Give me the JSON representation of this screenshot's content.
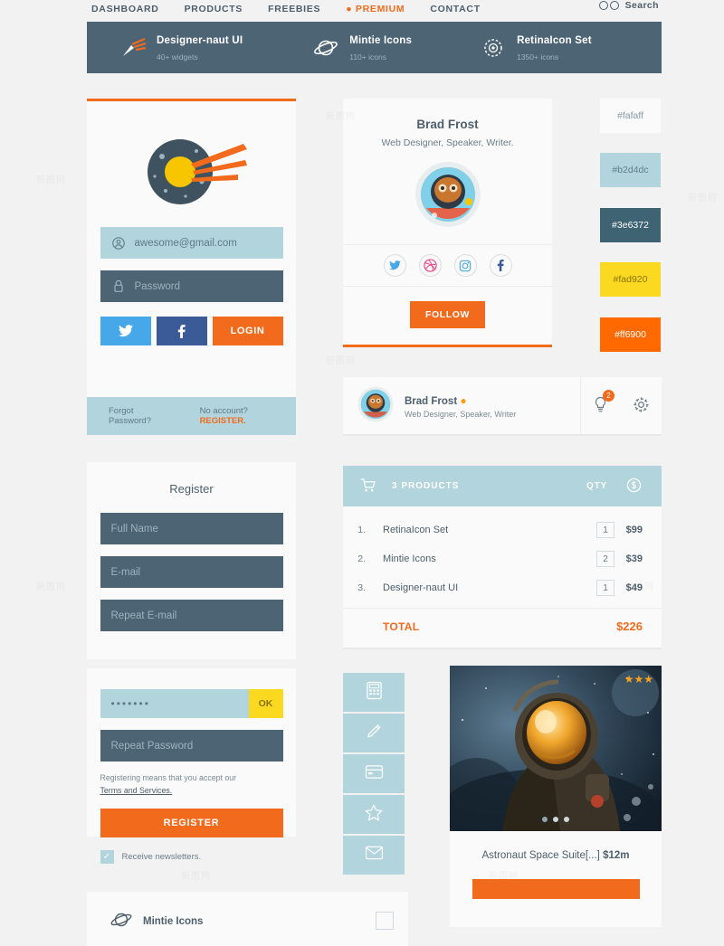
{
  "nav": {
    "links": [
      {
        "label": "DASHBOARD",
        "active": false
      },
      {
        "label": "PRODUCTS",
        "active": false
      },
      {
        "label": "FREEBIES",
        "active": false
      },
      {
        "label": "PREMIUM",
        "active": true
      },
      {
        "label": "CONTACT",
        "active": false
      }
    ],
    "search_label": "Search"
  },
  "hero": {
    "items": [
      {
        "title": "Designer-naut UI",
        "subtitle": "40+ widgets",
        "icon": "comet-icon"
      },
      {
        "title": "Mintie Icons",
        "subtitle": "110+ icons",
        "icon": "planet-icon"
      },
      {
        "title": "RetinaIcon Set",
        "subtitle": "1350+ icons",
        "icon": "globe-icon"
      }
    ]
  },
  "login": {
    "email_value": "awesome@gmail.com",
    "password_placeholder": "Password",
    "twitter_label": "",
    "facebook_label": "",
    "login_label": "LOGIN",
    "forgot_label": "Forgot Password?",
    "no_account_label": "No account?",
    "register_link": "REGISTER."
  },
  "register": {
    "title": "Register",
    "fields": [
      {
        "placeholder": "Full Name"
      },
      {
        "placeholder": "E-mail"
      },
      {
        "placeholder": "Repeat E-mail"
      }
    ]
  },
  "password": {
    "value": "•••••••",
    "ok_label": "OK",
    "repeat_placeholder": "Repeat Password",
    "terms_text": "Registering means that you accept our",
    "terms_link": "Terms and Services.",
    "register_button": "REGISTER",
    "newsletter_label": "Receive newsletters.",
    "checkbox_mark": "✓"
  },
  "bottom_card": {
    "title": "Mintie Icons"
  },
  "profile": {
    "name": "Brad Frost",
    "role": "Web Designer, Speaker, Writer.",
    "socials": [
      "twitter-icon",
      "dribbble-icon",
      "instagram-icon",
      "facebook-icon"
    ],
    "follow_label": "FOLLOW"
  },
  "user_bar": {
    "name": "Brad Frost",
    "status_dot": "●",
    "role": "Web Designer, Speaker, Writer",
    "notification_count": "2",
    "bulb_icon": "lightbulb-icon",
    "gear_icon": "gear-icon"
  },
  "cart": {
    "header_title": "3 PRODUCTS",
    "header_qty": "QTY",
    "columns": [
      "",
      "",
      "QTY",
      ""
    ],
    "rows": [
      {
        "num": "1.",
        "name": "RetinaIcon Set",
        "qty": "1",
        "price": "$99"
      },
      {
        "num": "2.",
        "name": "Mintie Icons",
        "qty": "2",
        "price": "$39"
      },
      {
        "num": "3.",
        "name": "Designer-naut UI",
        "qty": "1",
        "price": "$49"
      }
    ],
    "total_label": "TOTAL",
    "total_value": "$226"
  },
  "tools": [
    {
      "icon": "calculator-icon"
    },
    {
      "icon": "pencil-icon"
    },
    {
      "icon": "credit-card-icon"
    },
    {
      "icon": "star-icon"
    },
    {
      "icon": "envelope-icon"
    }
  ],
  "product": {
    "title": "Astronaut Space Suite[...]",
    "price": "$12m",
    "stars": "★★★",
    "dots": 3,
    "active_dot": 0
  },
  "swatches": [
    {
      "label": "#fafaff",
      "bg": "#fafafa",
      "fg": "#8a99a3"
    },
    {
      "label": "#b2d4dc",
      "bg": "#b2d4dc",
      "fg": "#5f7f8b"
    },
    {
      "label": "#3e6372",
      "bg": "#3e6372",
      "fg": "#ffffff"
    },
    {
      "label": "#fad920",
      "bg": "#fad920",
      "fg": "#8a7400"
    },
    {
      "label": "#ff6900",
      "bg": "#ff6900",
      "fg": "#ffffff"
    }
  ],
  "watermark": "新图网"
}
